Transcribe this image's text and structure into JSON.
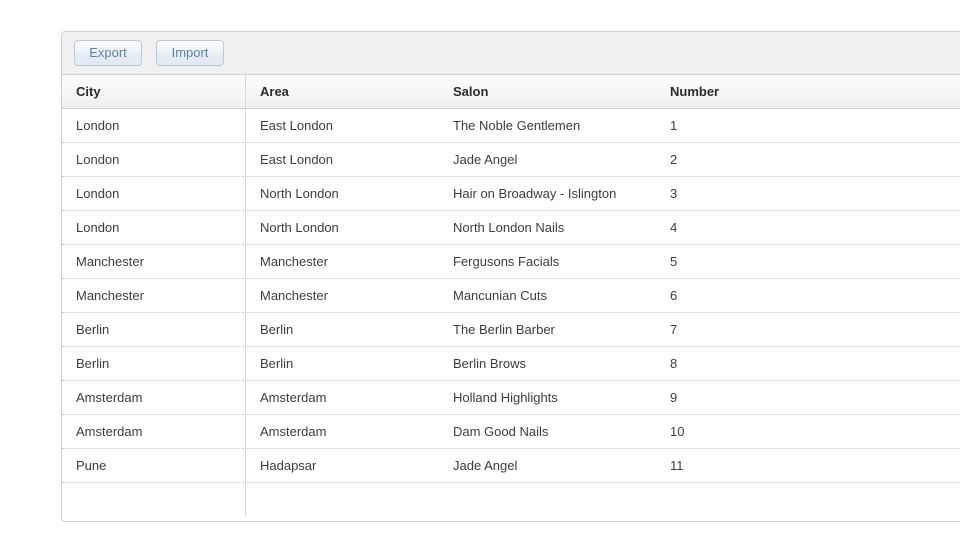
{
  "toolbar": {
    "export_label": "Export",
    "import_label": "Import"
  },
  "grid": {
    "columns": [
      {
        "key": "city",
        "label": "City"
      },
      {
        "key": "area",
        "label": "Area"
      },
      {
        "key": "salon",
        "label": "Salon"
      },
      {
        "key": "number",
        "label": "Number"
      }
    ],
    "rows": [
      {
        "city": "London",
        "area": "East London",
        "salon": "The Noble Gentlemen",
        "number": "1"
      },
      {
        "city": "London",
        "area": "East London",
        "salon": "Jade Angel",
        "number": "2"
      },
      {
        "city": "London",
        "area": "North London",
        "salon": "Hair on Broadway - Islington",
        "number": "3"
      },
      {
        "city": "London",
        "area": "North London",
        "salon": "North London Nails",
        "number": "4"
      },
      {
        "city": "Manchester",
        "area": "Manchester",
        "salon": "Fergusons Facials",
        "number": "5"
      },
      {
        "city": "Manchester",
        "area": "Manchester",
        "salon": "Mancunian Cuts",
        "number": "6"
      },
      {
        "city": "Berlin",
        "area": "Berlin",
        "salon": "The Berlin Barber",
        "number": "7"
      },
      {
        "city": "Berlin",
        "area": "Berlin",
        "salon": "Berlin Brows",
        "number": "8"
      },
      {
        "city": "Amsterdam",
        "area": "Amsterdam",
        "salon": "Holland Highlights",
        "number": "9"
      },
      {
        "city": "Amsterdam",
        "area": "Amsterdam",
        "salon": "Dam Good Nails",
        "number": "10"
      },
      {
        "city": "Pune",
        "area": "Hadapsar",
        "salon": "Jade Angel",
        "number": "11"
      },
      {
        "city": "",
        "area": "",
        "salon": "",
        "number": ""
      }
    ]
  },
  "colors": {
    "toolbar_bg": "#f0f0f0",
    "button_text": "#5d83a8",
    "button_border": "#b7cbdc",
    "header_text": "#2b2b2b",
    "body_text": "#3d3d3d",
    "panel_border": "#d0d0d0",
    "row_divider": "#c9c9c9"
  }
}
